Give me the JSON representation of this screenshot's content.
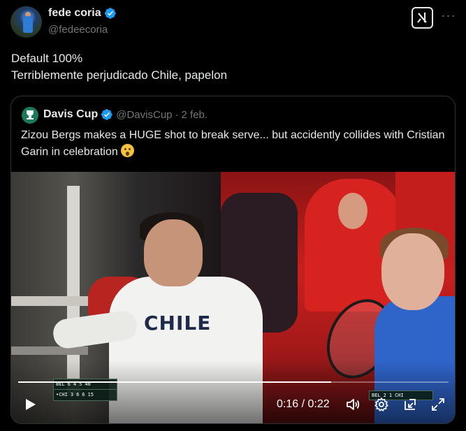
{
  "author": {
    "display_name": "fede coria",
    "handle": "@fedeecoria",
    "verified_icon": "verified-badge-icon"
  },
  "tweet": {
    "lines": [
      "Default 100%",
      "Terriblemente perjudicado Chile, papelon"
    ]
  },
  "quoted": {
    "display_name": "Davis Cup",
    "handle": "@DavisCup",
    "separator": "·",
    "date": "2 feb.",
    "text": "Zizou Bergs makes a HUGE shot to break serve... but accidently collides with Cristian Garin in celebration",
    "emoji": "astonished-face-emoji",
    "video": {
      "shirt_text": "CHILE",
      "current_time": "0:16",
      "duration": "0:22",
      "time_display": "0:16 / 0:22",
      "progress": 0.727,
      "scoreboard_left": [
        {
          "team": "BEL",
          "s1": "6",
          "s2": "4",
          "s3": "5",
          "pts": "40"
        },
        {
          "team": "•CHI",
          "s1": "3",
          "s2": "6",
          "s3": "6",
          "pts": "15"
        }
      ],
      "scoreboard_right": {
        "team1": "BEL",
        "s1": "2",
        "s2": "1",
        "team2": "CHI"
      }
    }
  },
  "colors": {
    "background": "#000000",
    "text": "#e7e9ea",
    "secondary": "#71767b",
    "verified": "#1d9bf0",
    "border": "#2f3336"
  }
}
